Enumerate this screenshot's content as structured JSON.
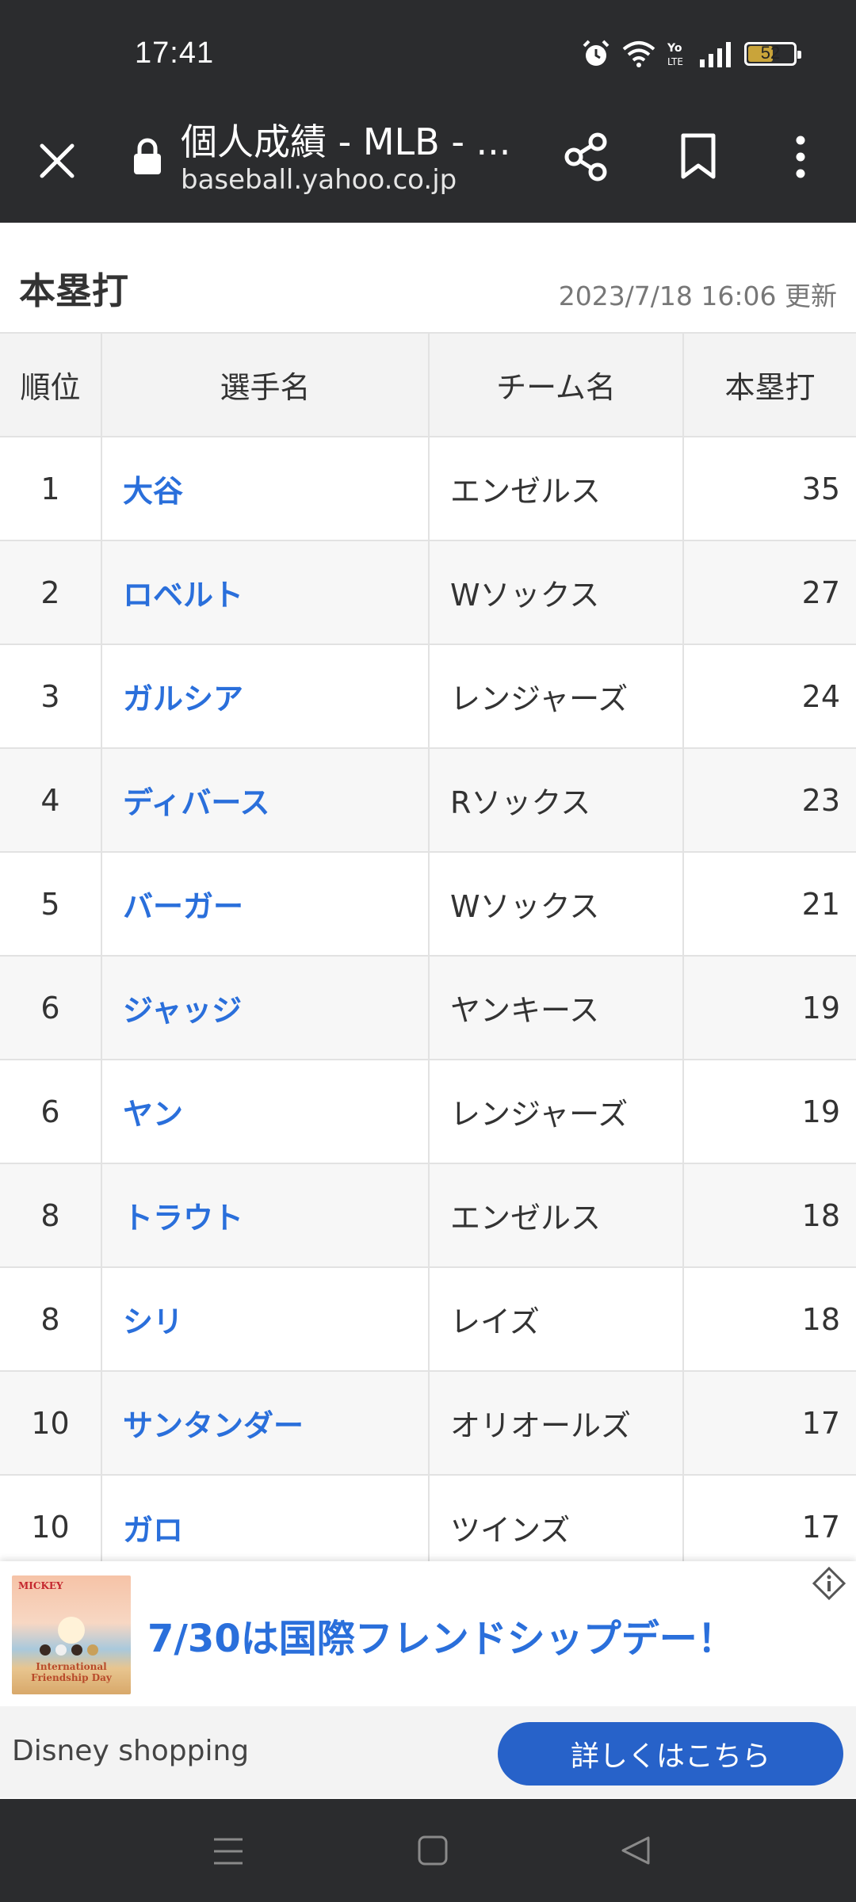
{
  "status_bar": {
    "time": "17:41",
    "battery_level": "52",
    "icons": [
      "alarm-icon",
      "wifi-icon",
      "volte-icon",
      "signal-icon",
      "battery-icon"
    ]
  },
  "browser": {
    "page_title": "個人成績 - MLB - ...",
    "url": "baseball.yahoo.co.jp",
    "icons": [
      "close-icon",
      "lock-icon",
      "share-icon",
      "bookmark-icon",
      "more-icon"
    ]
  },
  "section": {
    "title": "本塁打",
    "updated": "2023/7/18 16:06 更新"
  },
  "table": {
    "headers": [
      "順位",
      "選手名",
      "チーム名",
      "本塁打"
    ],
    "rows": [
      {
        "rank": "1",
        "player": "大谷",
        "team": "エンゼルス",
        "hr": "35"
      },
      {
        "rank": "2",
        "player": "ロベルト",
        "team": "Wソックス",
        "hr": "27"
      },
      {
        "rank": "3",
        "player": "ガルシア",
        "team": "レンジャーズ",
        "hr": "24"
      },
      {
        "rank": "4",
        "player": "ディバース",
        "team": "Rソックス",
        "hr": "23"
      },
      {
        "rank": "5",
        "player": "バーガー",
        "team": "Wソックス",
        "hr": "21"
      },
      {
        "rank": "6",
        "player": "ジャッジ",
        "team": "ヤンキース",
        "hr": "19"
      },
      {
        "rank": "6",
        "player": "ヤン",
        "team": "レンジャーズ",
        "hr": "19"
      },
      {
        "rank": "8",
        "player": "トラウト",
        "team": "エンゼルス",
        "hr": "18"
      },
      {
        "rank": "8",
        "player": "シリ",
        "team": "レイズ",
        "hr": "18"
      },
      {
        "rank": "10",
        "player": "サンタンダー",
        "team": "オリオールズ",
        "hr": "17"
      },
      {
        "rank": "10",
        "player": "ガロ",
        "team": "ツインズ",
        "hr": "17"
      }
    ]
  },
  "ad": {
    "headline": "7/30は国際フレンドシップデー！",
    "advertiser": "Disney shopping",
    "cta": "詳しくはこちら",
    "image_logo": "MICKEY",
    "image_caption": "International Friendship Day"
  },
  "colors": {
    "chrome": "#2b2c2e",
    "link": "#2a6fdb",
    "cta": "#2762c9"
  }
}
